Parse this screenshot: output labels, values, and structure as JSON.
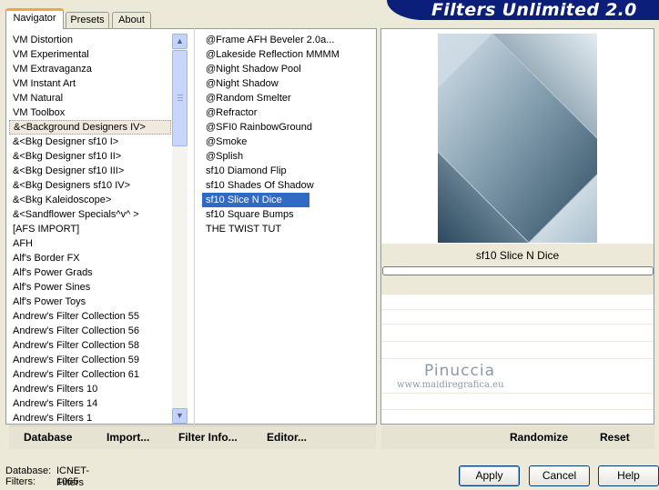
{
  "header": {
    "title": "Filters Unlimited 2.0"
  },
  "tabs": [
    {
      "label": "Navigator",
      "active": true
    },
    {
      "label": "Presets",
      "active": false
    },
    {
      "label": "About",
      "active": false
    }
  ],
  "categories": [
    "VM Distortion",
    "VM Experimental",
    "VM Extravaganza",
    "VM Instant Art",
    "VM Natural",
    "VM Toolbox",
    "&<Background Designers IV>",
    "&<Bkg Designer sf10 I>",
    "&<Bkg Designer sf10 II>",
    "&<Bkg Designer sf10 III>",
    "&<Bkg Designers sf10 IV>",
    "&<Bkg Kaleidoscope>",
    "&<Sandflower Specials^v^ >",
    "[AFS IMPORT]",
    "AFH",
    "Alf's Border FX",
    "Alf's Power Grads",
    "Alf's Power Sines",
    "Alf's Power Toys",
    "Andrew's Filter Collection 55",
    "Andrew's Filter Collection 56",
    "Andrew's Filter Collection 58",
    "Andrew's Filter Collection 59",
    "Andrew's Filter Collection 61",
    "Andrew's Filters 10",
    "Andrew's Filters 14",
    "Andrew's Filters 1"
  ],
  "selected_category": "&<Background Designers IV>",
  "filters": [
    "@Frame AFH Beveler 2.0a...",
    "@Lakeside Reflection MMMM",
    "@Night Shadow Pool",
    "@Night Shadow",
    "@Random Smelter",
    "@Refractor",
    "@SFI0 RainbowGround",
    "@Smoke",
    "@Splish",
    "sf10 Diamond Flip",
    "sf10 Shades Of Shadow",
    "sf10 Slice N Dice",
    "sf10 Square Bumps",
    "THE TWIST TUT"
  ],
  "selected_filter": "sf10 Slice N Dice",
  "preview": {
    "label": "sf10 Slice N Dice",
    "progress": 0
  },
  "watermark": {
    "name": "Pinuccia",
    "url": "www.maidiregrafica.eu"
  },
  "toolbar": {
    "database": "Database",
    "import": "Import...",
    "filter_info": "Filter Info...",
    "editor": "Editor...",
    "randomize": "Randomize",
    "reset": "Reset"
  },
  "status": {
    "database_label": "Database:",
    "database_value": "ICNET-Filters",
    "filters_label": "Filters:",
    "filters_value": "1065"
  },
  "buttons": {
    "apply": "Apply",
    "cancel": "Cancel",
    "help": "Help"
  },
  "colors": {
    "banner": "#0a1e7a",
    "selection": "#316ac5",
    "tab_accent": "#f0a73c"
  }
}
